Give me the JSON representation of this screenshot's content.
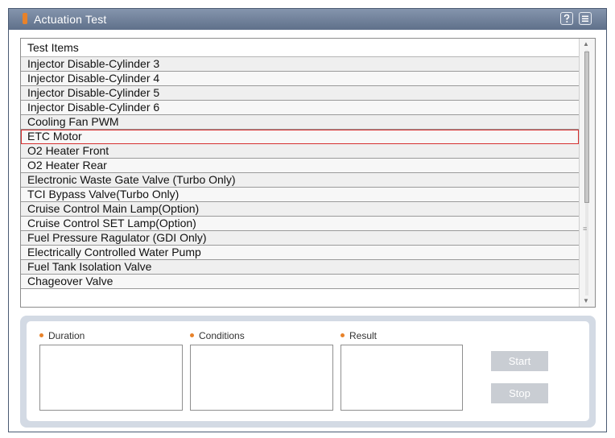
{
  "window": {
    "title": "Actuation Test",
    "help_icon": "help-question-icon",
    "menu_icon": "menu-icon"
  },
  "list": {
    "header": "Test Items",
    "items": [
      "Injector Disable-Cylinder 3",
      "Injector Disable-Cylinder 4",
      "Injector Disable-Cylinder 5",
      "Injector Disable-Cylinder 6",
      "Cooling Fan PWM",
      "ETC Motor",
      "O2 Heater Front",
      "O2 Heater Rear",
      "Electronic Waste Gate Valve (Turbo Only)",
      "TCI Bypass Valve(Turbo Only)",
      "Cruise Control Main Lamp(Option)",
      "Cruise Control SET Lamp(Option)",
      "Fuel Pressure Ragulator (GDI Only)",
      "Electrically Controlled Water Pump",
      "Fuel Tank Isolation Valve",
      "Chageover Valve"
    ],
    "selected_index": 5,
    "selected_outline_color": "#d63030"
  },
  "panel": {
    "duration_label": "Duration",
    "conditions_label": "Conditions",
    "result_label": "Result",
    "duration_value": "",
    "conditions_value": "",
    "result_value": "",
    "start_label": "Start",
    "stop_label": "Stop"
  },
  "colors": {
    "title_bar": "#5f708a",
    "accent_orange": "#e8822a",
    "button_disabled": "#c9cdd3"
  }
}
